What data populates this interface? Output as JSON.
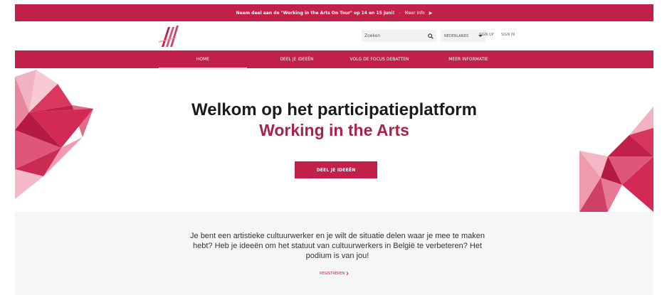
{
  "promo": {
    "text": "Neem deel aan de \"Working in the Arts On Tour\" op 14 en 15 juni!",
    "separator": "-",
    "link_label": "Meer info",
    "arrow": "▶"
  },
  "header": {
    "search_placeholder": "Zoeken",
    "language": "NEDERLANDS",
    "signup_label": "SIGN UP",
    "signin_label": "SIGN IN"
  },
  "nav": {
    "items": [
      {
        "label": "HOME",
        "active": true
      },
      {
        "label": "DEEL JE IDEEËN",
        "active": false
      },
      {
        "label": "VOLG DE FOCUS DEBATTEN",
        "active": false
      },
      {
        "label": "MEER INFORMATIE",
        "active": false
      }
    ]
  },
  "hero": {
    "title": "Welkom op het participatieplatform",
    "subtitle": "Working in the Arts",
    "button_label": "DEEL JE IDEEËN"
  },
  "intro": {
    "text": "Je bent een artistieke cultuurwerker en je wilt de situatie delen waar je mee te maken hebt? Heb je ideeën om het statuut van cultuurwerkers in België te verbeteren? Het podium is van jou!",
    "register_label": "REGISTREREN ❯"
  },
  "colors": {
    "brand": "#c1204a",
    "brand_dark": "#a8244a",
    "intro_bg": "#f6f6f6"
  },
  "icons": {
    "search": "search-icon",
    "caret": "chevron-down-icon",
    "logo": "logo"
  }
}
